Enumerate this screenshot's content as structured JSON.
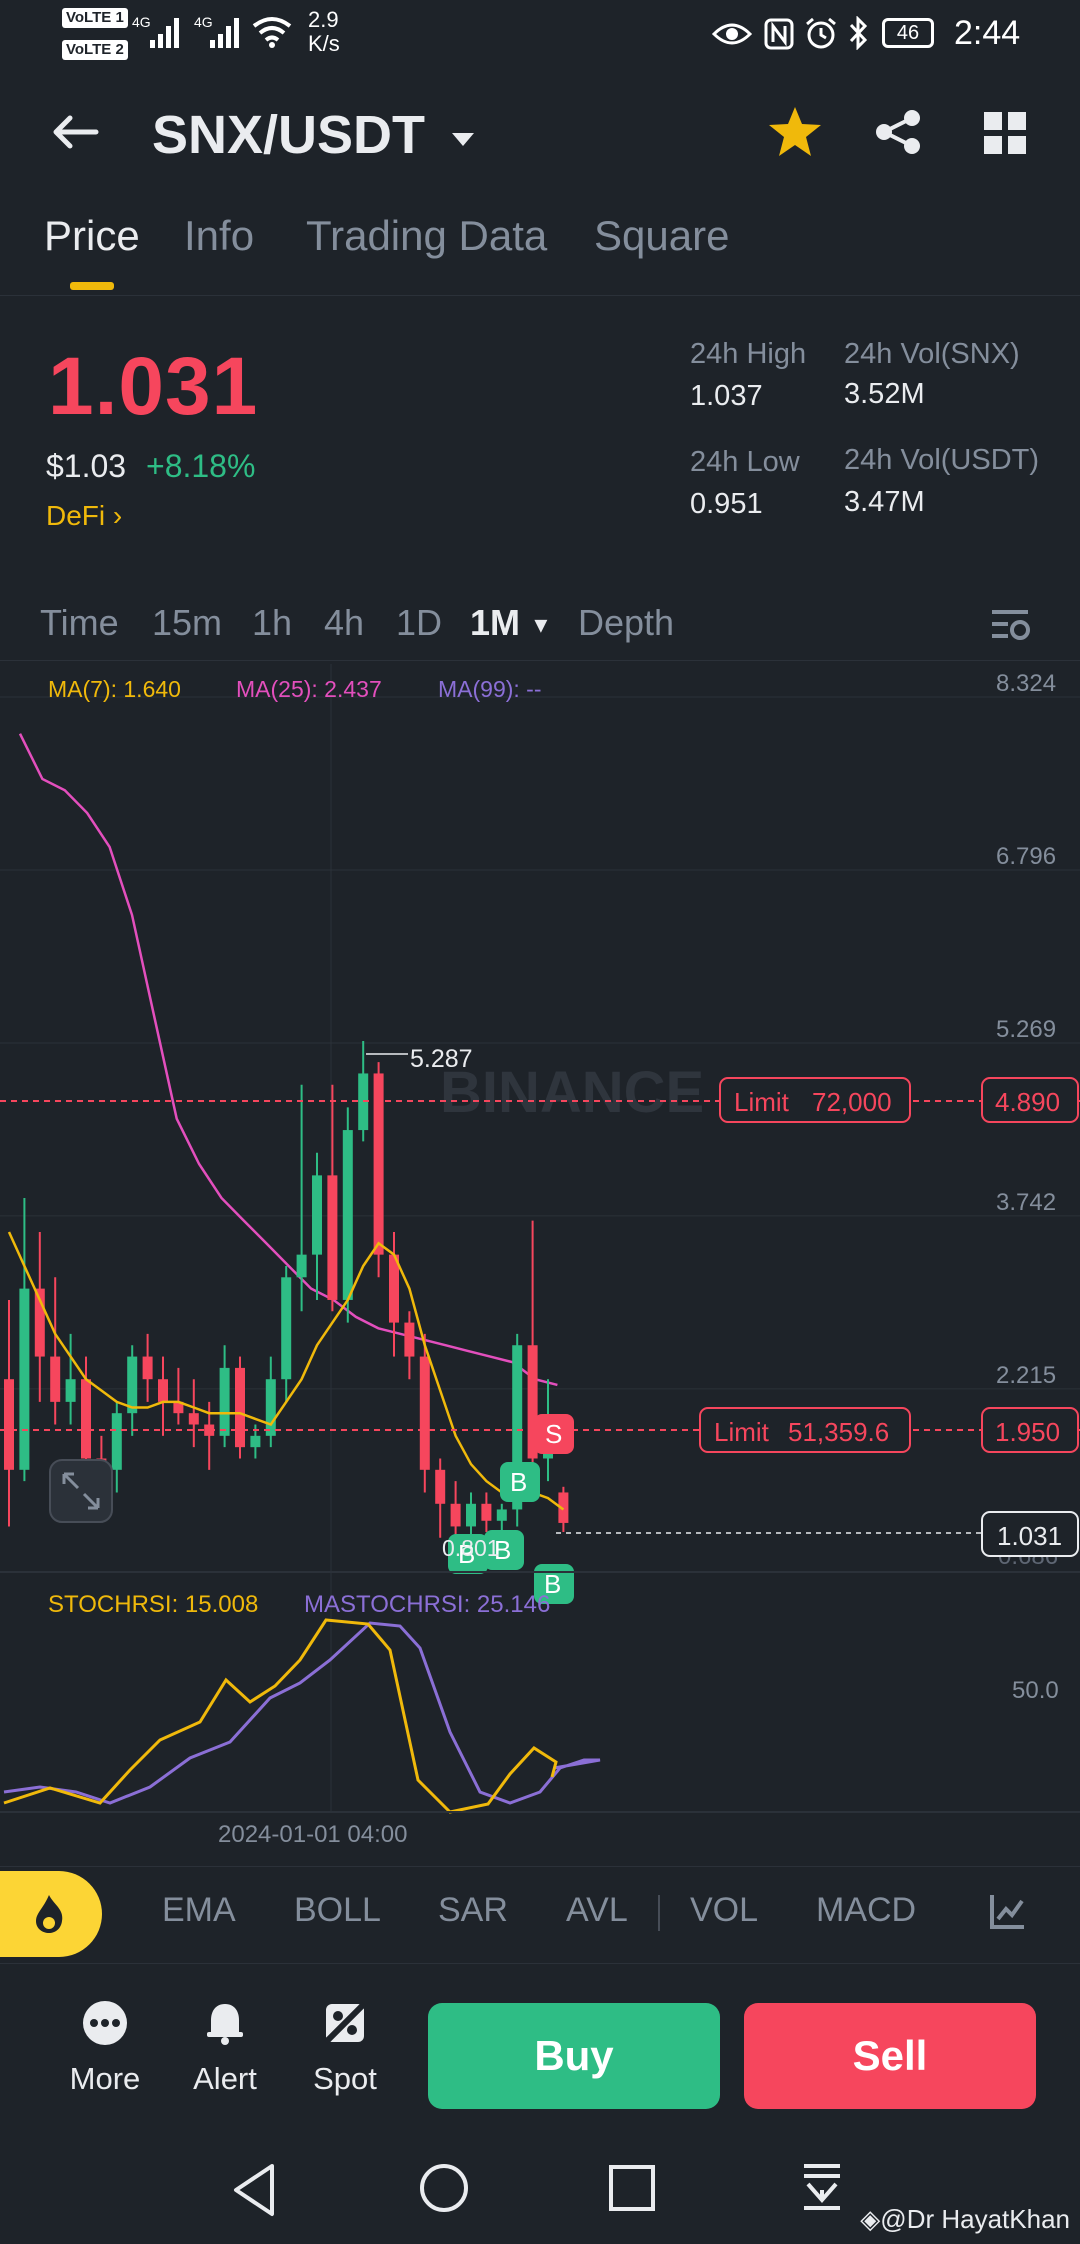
{
  "status_bar": {
    "sim1": "VoLTE 1",
    "sim2": "VoLTE 2",
    "net1": "4G",
    "net2": "4G",
    "speed_value": "2.9",
    "speed_unit": "K/s",
    "battery": "46",
    "time": "2:44"
  },
  "header": {
    "pair": "SNX/USDT",
    "back_icon": "arrow-left-icon",
    "dropdown_icon": "caret-down-icon",
    "favorite_icon": "star-icon",
    "share_icon": "share-icon",
    "grid_icon": "grid-icon"
  },
  "tabs": [
    "Price",
    "Info",
    "Trading Data",
    "Square"
  ],
  "ticker": {
    "last_price": "1.031",
    "usd_price": "$1.03",
    "change": "+8.18%",
    "tag": "DeFi",
    "high_label": "24h High",
    "high_value": "1.037",
    "low_label": "24h Low",
    "low_value": "0.951",
    "vol_base_label": "24h Vol(SNX)",
    "vol_base_value": "3.52M",
    "vol_quote_label": "24h Vol(USDT)",
    "vol_quote_value": "3.47M"
  },
  "timeframes": [
    "Time",
    "15m",
    "1h",
    "4h",
    "1D",
    "1M",
    "Depth"
  ],
  "active_timeframe": "1M",
  "chart": {
    "ma7": "MA(7): 1.640",
    "ma25": "MA(25): 2.437",
    "ma99": "MA(99): --",
    "watermark": "BINANCE",
    "high_marker": "5.287",
    "low_marker": "0.801",
    "limit_sell_label": "Limit",
    "limit_sell_qty": "72,000",
    "limit_sell_price": "4.890",
    "limit_buy_label": "Limit",
    "limit_buy_qty": "51,359.6",
    "limit_buy_price": "1.950",
    "current_price_tag": "1.031",
    "axis_partial": "0.686",
    "stoch": "STOCHRSI: 15.008",
    "mastoch": "MASTOCHRSI: 25.146",
    "stoch_axis": "50.0",
    "date_label": "2024-01-01 04:00",
    "sell_marker": "S",
    "buy_marker": "B"
  },
  "chart_data": {
    "type": "candlestick",
    "y_ticks": [
      "8.324",
      "6.796",
      "5.269",
      "3.742",
      "2.215"
    ],
    "ylim": [
      0.686,
      8.324
    ],
    "candles": [
      {
        "o": 2.3,
        "h": 3.0,
        "l": 1.0,
        "c": 1.5
      },
      {
        "o": 1.5,
        "h": 3.9,
        "l": 1.4,
        "c": 3.1
      },
      {
        "o": 3.1,
        "h": 3.6,
        "l": 2.1,
        "c": 2.5
      },
      {
        "o": 2.5,
        "h": 3.2,
        "l": 1.9,
        "c": 2.1
      },
      {
        "o": 2.1,
        "h": 2.7,
        "l": 1.9,
        "c": 2.3
      },
      {
        "o": 2.3,
        "h": 2.5,
        "l": 1.4,
        "c": 1.6
      },
      {
        "o": 1.6,
        "h": 1.8,
        "l": 1.3,
        "c": 1.5
      },
      {
        "o": 1.5,
        "h": 2.1,
        "l": 1.3,
        "c": 2.0
      },
      {
        "o": 2.0,
        "h": 2.6,
        "l": 1.8,
        "c": 2.5
      },
      {
        "o": 2.5,
        "h": 2.7,
        "l": 2.1,
        "c": 2.3
      },
      {
        "o": 2.3,
        "h": 2.5,
        "l": 1.8,
        "c": 2.1
      },
      {
        "o": 2.1,
        "h": 2.4,
        "l": 1.9,
        "c": 2.0
      },
      {
        "o": 2.0,
        "h": 2.3,
        "l": 1.7,
        "c": 1.9
      },
      {
        "o": 1.9,
        "h": 2.1,
        "l": 1.5,
        "c": 1.8
      },
      {
        "o": 1.8,
        "h": 2.6,
        "l": 1.7,
        "c": 2.4
      },
      {
        "o": 2.4,
        "h": 2.5,
        "l": 1.6,
        "c": 1.7
      },
      {
        "o": 1.7,
        "h": 1.9,
        "l": 1.6,
        "c": 1.8
      },
      {
        "o": 1.8,
        "h": 2.5,
        "l": 1.7,
        "c": 2.3
      },
      {
        "o": 2.3,
        "h": 3.3,
        "l": 2.1,
        "c": 3.2
      },
      {
        "o": 3.2,
        "h": 4.9,
        "l": 2.9,
        "c": 3.4
      },
      {
        "o": 3.4,
        "h": 4.3,
        "l": 3.0,
        "c": 4.1
      },
      {
        "o": 4.1,
        "h": 4.9,
        "l": 2.9,
        "c": 3.0
      },
      {
        "o": 3.0,
        "h": 4.7,
        "l": 2.8,
        "c": 4.5
      },
      {
        "o": 4.5,
        "h": 5.287,
        "l": 4.4,
        "c": 5.0
      },
      {
        "o": 5.0,
        "h": 5.1,
        "l": 3.2,
        "c": 3.4
      },
      {
        "o": 3.4,
        "h": 3.6,
        "l": 2.5,
        "c": 2.8
      },
      {
        "o": 2.8,
        "h": 2.9,
        "l": 2.3,
        "c": 2.5
      },
      {
        "o": 2.5,
        "h": 2.7,
        "l": 1.3,
        "c": 1.5
      },
      {
        "o": 1.5,
        "h": 1.6,
        "l": 0.9,
        "c": 1.2
      },
      {
        "o": 1.2,
        "h": 1.4,
        "l": 0.801,
        "c": 1.0
      },
      {
        "o": 1.0,
        "h": 1.3,
        "l": 0.9,
        "c": 1.2
      },
      {
        "o": 1.2,
        "h": 1.3,
        "l": 0.95,
        "c": 1.05
      },
      {
        "o": 1.05,
        "h": 1.2,
        "l": 0.95,
        "c": 1.15
      },
      {
        "o": 1.15,
        "h": 2.7,
        "l": 1.0,
        "c": 2.6
      },
      {
        "o": 2.6,
        "h": 3.7,
        "l": 1.4,
        "c": 1.6
      },
      {
        "o": 1.6,
        "h": 2.3,
        "l": 1.4,
        "c": 1.8
      },
      {
        "o": 1.3,
        "h": 1.35,
        "l": 0.951,
        "c": 1.031
      }
    ],
    "ma7": [
      3.6,
      3.3,
      3.0,
      2.7,
      2.5,
      2.3,
      2.2,
      2.1,
      2.05,
      2.05,
      2.1,
      2.1,
      2.05,
      2.0,
      2.0,
      2.0,
      1.95,
      1.9,
      2.1,
      2.3,
      2.6,
      2.8,
      3.0,
      3.3,
      3.5,
      3.4,
      3.1,
      2.6,
      2.2,
      1.8,
      1.55,
      1.4,
      1.3,
      1.4,
      1.3,
      1.25,
      1.15
    ],
    "ma25": [
      8.0,
      7.6,
      7.5,
      7.3,
      7.0,
      6.4,
      5.5,
      4.6,
      4.2,
      3.9,
      3.7,
      3.5,
      3.3,
      3.1,
      3.0,
      2.85,
      2.75,
      2.7,
      2.65,
      2.6,
      2.55,
      2.5,
      2.45,
      2.3,
      2.25
    ]
  },
  "indicator_tabs": [
    "EMA",
    "BOLL",
    "SAR",
    "AVL",
    "VOL",
    "MACD"
  ],
  "bottom_actions": {
    "more": "More",
    "alert": "Alert",
    "spot": "Spot",
    "buy": "Buy",
    "sell": "Sell"
  },
  "colors": {
    "up": "#2ebd85",
    "down": "#f6465d",
    "ma7": "#f0b90b",
    "ma25": "#e34fbd",
    "ma99": "#8b6fd6",
    "brand": "#fcd535"
  },
  "watermark": "@Dr HayatKhan"
}
